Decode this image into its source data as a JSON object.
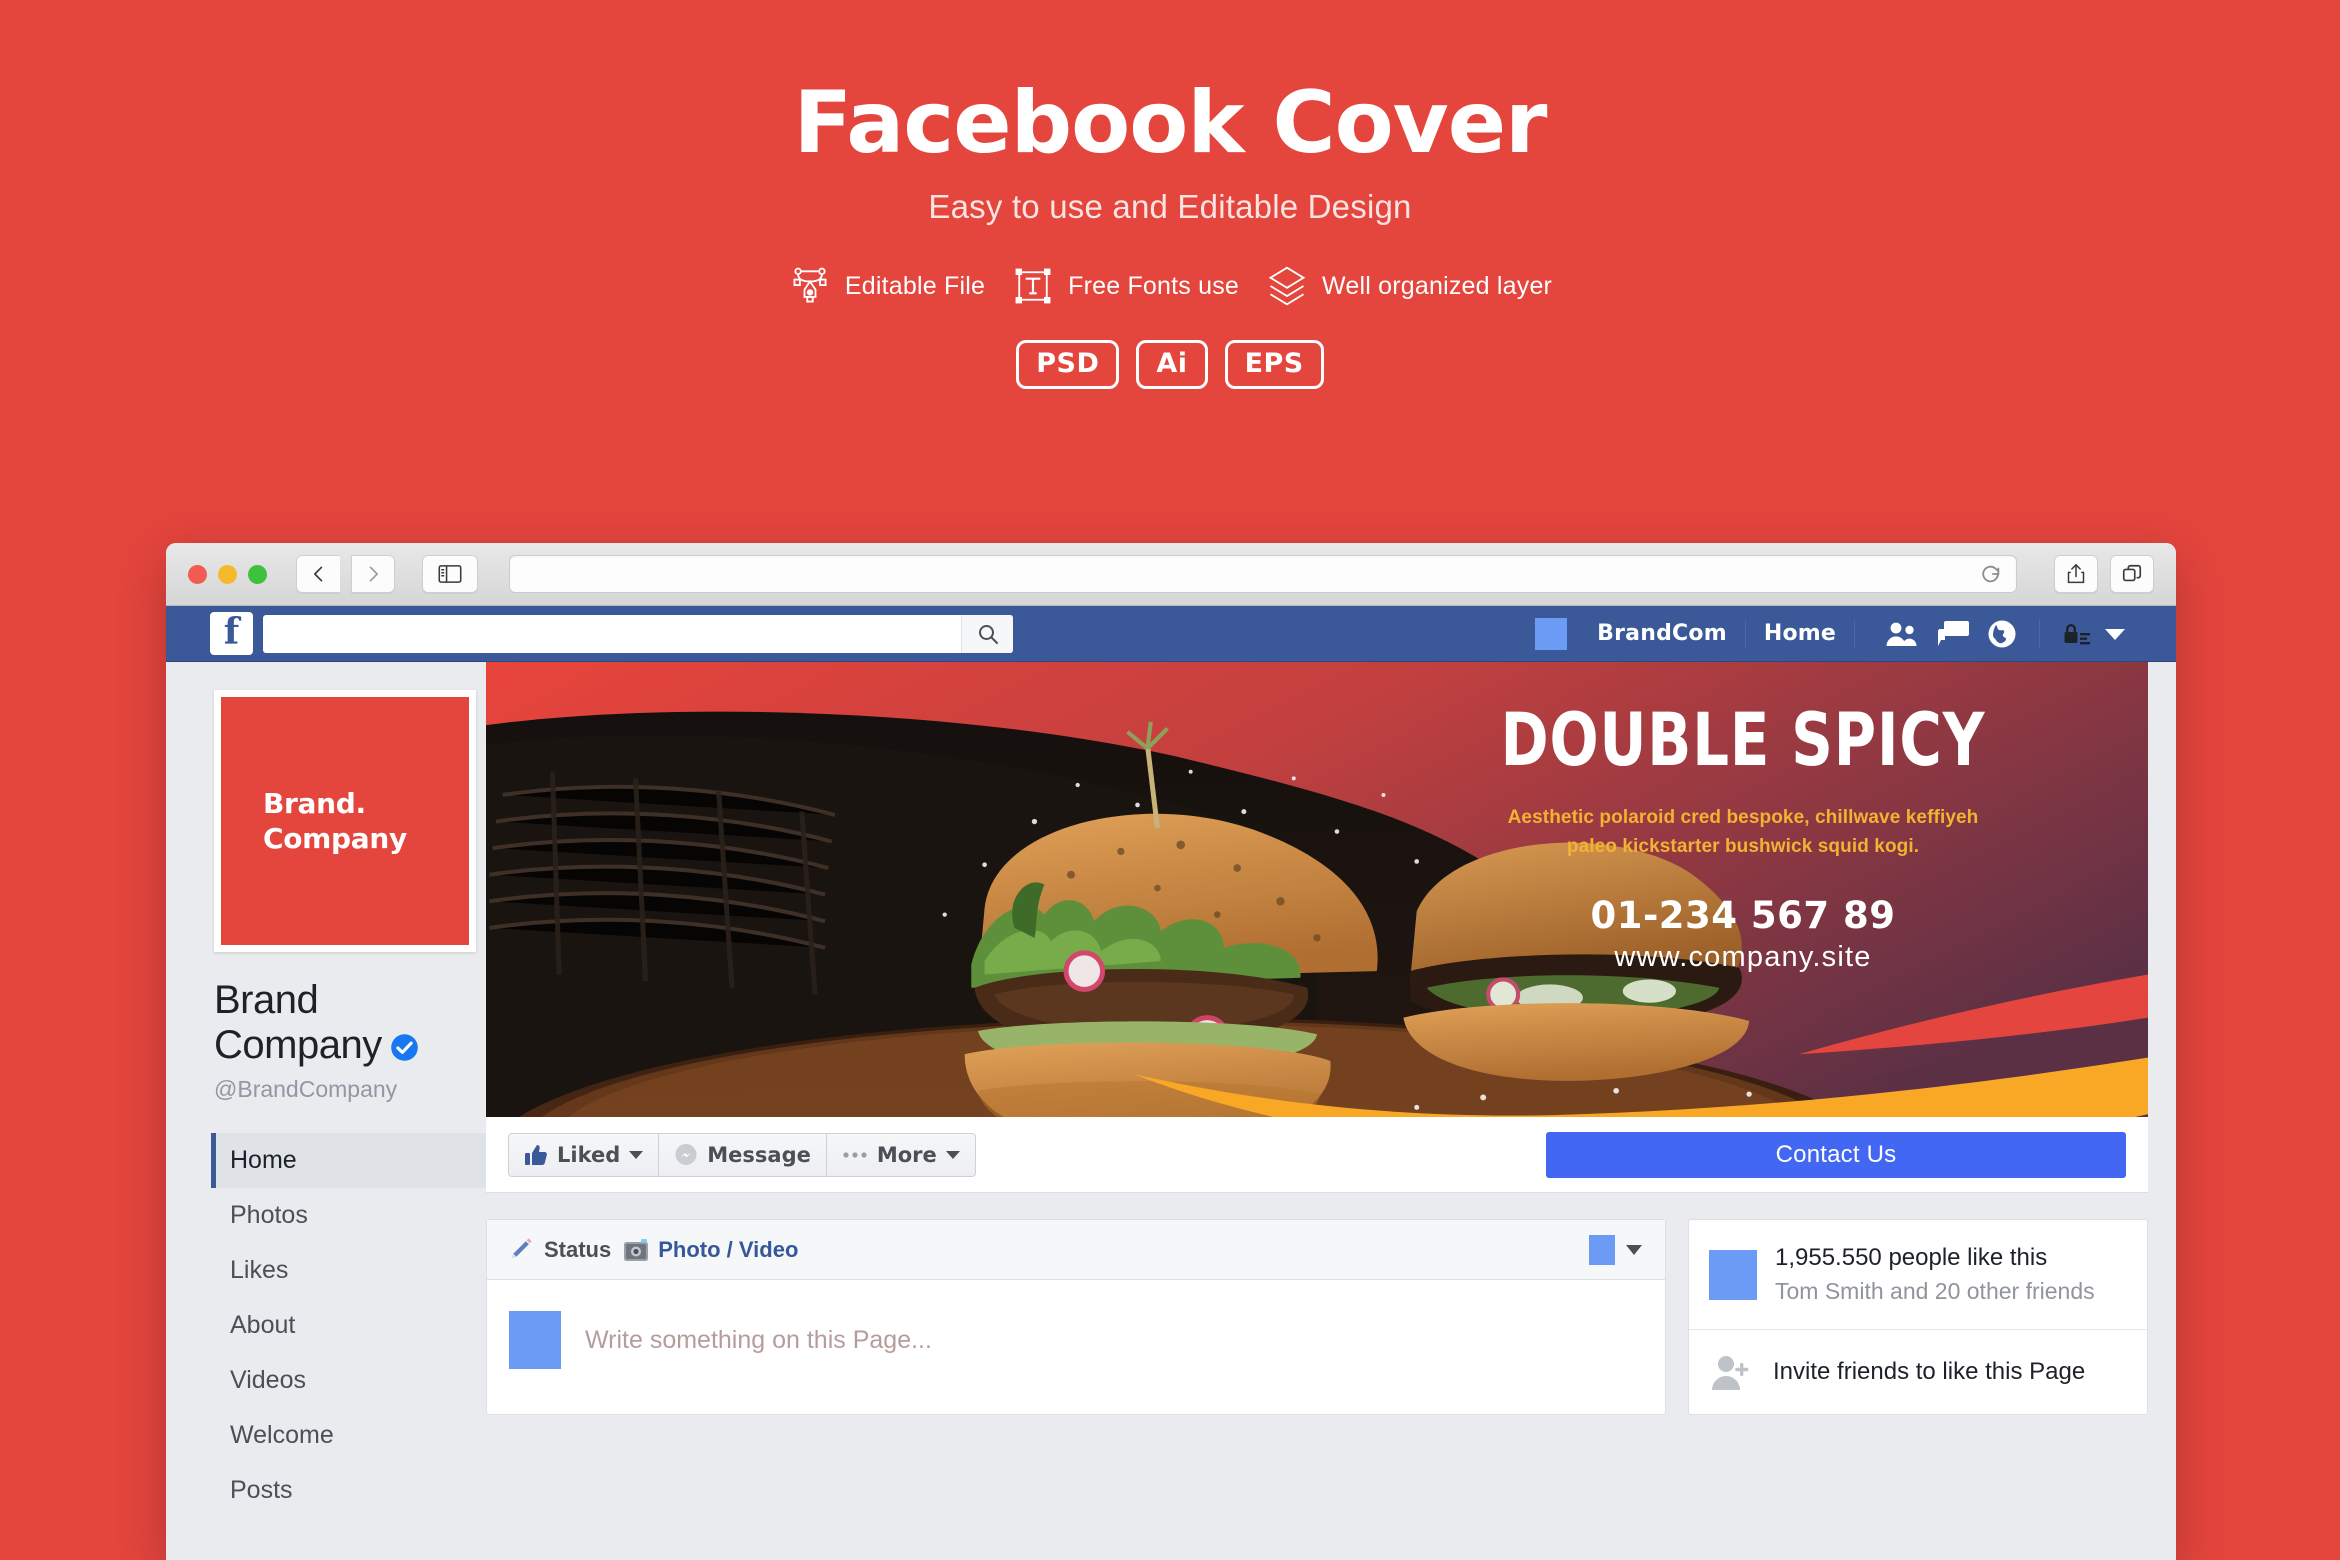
{
  "hero": {
    "title": "Facebook Cover",
    "subtitle": "Easy to use and Editable Design",
    "features": [
      {
        "icon": "pen-tool-icon",
        "label": "Editable File"
      },
      {
        "icon": "text-frame-icon",
        "label": "Free Fonts use"
      },
      {
        "icon": "layers-icon",
        "label": "Well organized layer"
      }
    ],
    "badges": [
      "PSD",
      "Ai",
      "EPS"
    ]
  },
  "browser": {
    "traffic_lights": [
      "close",
      "minimize",
      "zoom"
    ],
    "back_icon": "chevron-left-icon",
    "forward_icon": "chevron-right-icon",
    "sidebar_icon": "sidebar-toggle-icon",
    "url_value": "",
    "url_placeholder": "",
    "reload_icon": "reload-icon",
    "share_icon": "share-icon",
    "tabs_icon": "show-tabs-icon"
  },
  "fbnav": {
    "logo": "f",
    "search_value": "",
    "search_placeholder": "",
    "search_icon": "search-icon",
    "page_chip": "page-thumb",
    "page_name": "BrandCom",
    "home_label": "Home",
    "icons": [
      "friend-requests-icon",
      "messages-icon",
      "notifications-globe-icon"
    ],
    "privacy_icon": "privacy-lock-icon",
    "account_caret": "chevron-down-icon"
  },
  "profile": {
    "logo_line1": "Brand.",
    "logo_line2": "Company",
    "name_line1": "Brand",
    "name_line2": "Company",
    "verified_icon": "verified-badge-icon",
    "handle": "@BrandCompany"
  },
  "sidebar": {
    "items": [
      {
        "label": "Home",
        "active": true
      },
      {
        "label": "Photos",
        "active": false
      },
      {
        "label": "Likes",
        "active": false
      },
      {
        "label": "About",
        "active": false
      },
      {
        "label": "Videos",
        "active": false
      },
      {
        "label": "Welcome",
        "active": false
      },
      {
        "label": "Posts",
        "active": false
      }
    ]
  },
  "cover": {
    "headline": "DOUBLE SPICY",
    "desc_line1": "Aesthetic polaroid cred bespoke, chillwave keffiyeh",
    "desc_line2": "paleo kickstarter bushwick squid kogi.",
    "phone": "01-234 567 89",
    "website": "www.company.site"
  },
  "actions": {
    "liked_label": "Liked",
    "liked_icon": "thumbs-up-icon",
    "message_label": "Message",
    "message_icon": "messenger-icon",
    "more_label": "More",
    "more_icon": "ellipsis-icon",
    "contact_label": "Contact Us"
  },
  "composer": {
    "status_label": "Status",
    "status_icon": "pencil-icon",
    "photo_label": "Photo / Video",
    "photo_icon": "camera-icon",
    "audience_caret": "chevron-down-icon",
    "avatar": "page-avatar",
    "placeholder": "Write something on this Page..."
  },
  "likes_card": {
    "avatar": "likes-thumb",
    "count_text": "1,955.550 people like this",
    "friends_text": "Tom Smith and 20 other friends",
    "invite_icon": "add-friend-icon",
    "invite_text": "Invite friends to like this Page"
  },
  "colors": {
    "brand_red": "#e4453d",
    "fb_blue": "#3b5998",
    "fb_button_blue": "#4267f2",
    "cover_gold": "#f2b233",
    "cover_orange": "#f9a825",
    "page_bg": "#e9ebee"
  }
}
